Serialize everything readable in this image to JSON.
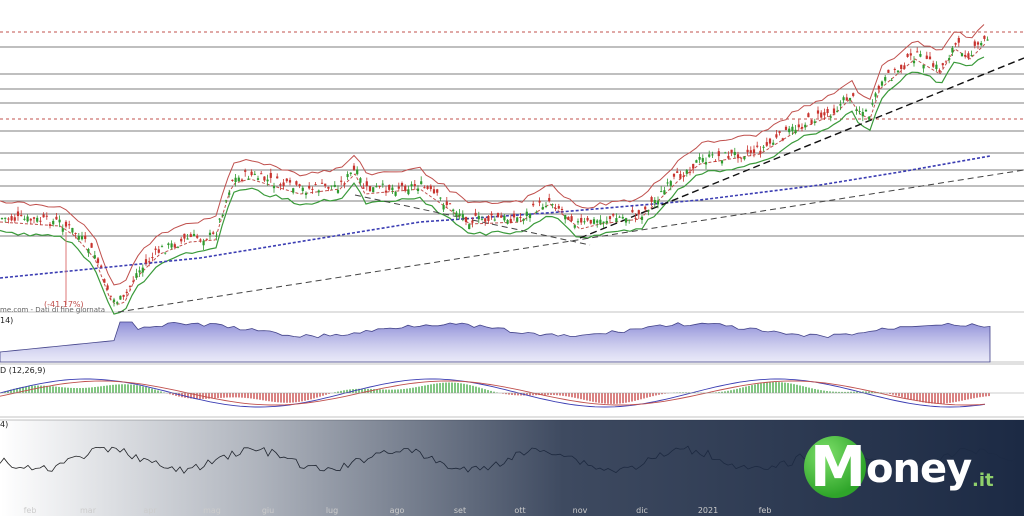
{
  "chart_data": [
    {
      "type": "candlestick",
      "panel": "price",
      "title": "",
      "x_months": [
        "feb",
        "mar",
        "apr",
        "mag",
        "giu",
        "lug",
        "ago",
        "set",
        "ott",
        "nov",
        "dic",
        "2021",
        "feb"
      ],
      "source_note": "me.com - Dati di fine giornata",
      "annotation": "(-41,17%)",
      "series": [
        {
          "name": "",
          "trend": "consolidation ~feb, crash to low mid-mar, recovery to plateau mag-lug, dip nov, strong uptrend to high late feb 2021"
        }
      ],
      "colors": {
        "up": "#2e9a2e",
        "down": "#c8332e",
        "resistance": "#c0504d",
        "support": "#3a9a3a",
        "ma_long": "#3b3db3"
      }
    },
    {
      "type": "area",
      "panel": "volume-indicator",
      "label": "14)",
      "color": "#9a9ad8"
    },
    {
      "type": "line",
      "panel": "macd",
      "label": "D (12,26,9)",
      "color_hist_up": "#2ea02e",
      "color_hist_down": "#c02e2e"
    },
    {
      "type": "line",
      "panel": "oscillator",
      "label": "4)"
    }
  ],
  "logo": {
    "m": "M",
    "word": "oney",
    "tld": ".it"
  }
}
